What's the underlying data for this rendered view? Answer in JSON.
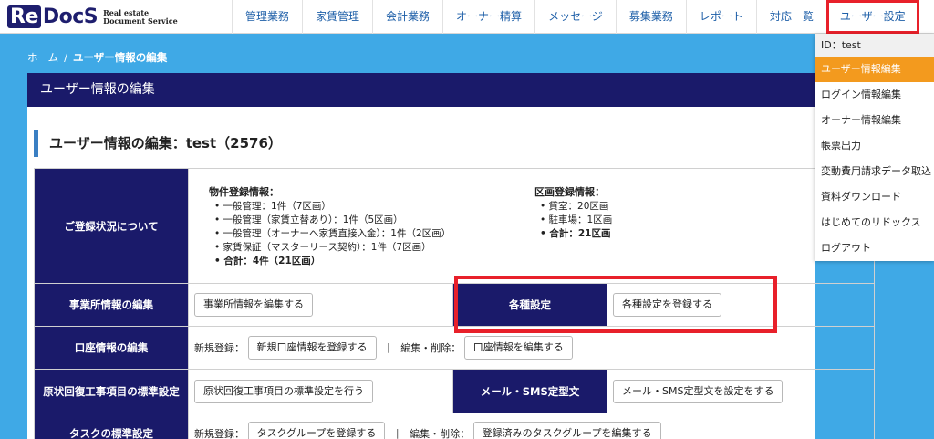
{
  "logo": {
    "mark_re": "Re",
    "mark_docs": "DocS",
    "sub_line1": "Real estate",
    "sub_line2": "Document Service"
  },
  "nav": [
    "管理業務",
    "家賃管理",
    "会計業務",
    "オーナー精算",
    "メッセージ",
    "募集業務",
    "レポート",
    "対応一覧",
    "ユーザー設定"
  ],
  "breadcrumb": {
    "home": "ホーム",
    "sep": "/",
    "current": "ユーザー情報の編集"
  },
  "panel": {
    "header": "ユーザー情報の編集",
    "title": "ユーザー情報の編集：test（2576）"
  },
  "registration": {
    "label": "ご登録状況について",
    "property_title": "物件登録情報：",
    "property_items": [
      "一般管理：1件（7区画）",
      "一般管理（家賃立替あり）：1件（5区画）",
      "一般管理（オーナーへ家賃直接入金）：1件（2区画）",
      "家賃保証（マスターリース契約）：1件（7区画）"
    ],
    "property_total": "合計：4件（21区画）",
    "unit_title": "区画登録情報：",
    "unit_items": [
      "貸室：20区画",
      "駐車場：1区画"
    ],
    "unit_total": "合計：21区画"
  },
  "rows": {
    "office": {
      "label": "事業所情報の編集",
      "button": "事業所情報を編集する"
    },
    "settings": {
      "label": "各種設定",
      "button": "各種設定を登録する"
    },
    "bank": {
      "label": "口座情報の編集",
      "new_label": "新規登録：",
      "new_button": "新規口座情報を登録する",
      "divider": "|",
      "edit_label": "編集・削除：",
      "edit_button": "口座情報を編集する"
    },
    "restore": {
      "label": "原状回復工事項目の標準設定",
      "button": "原状回復工事項目の標準設定を行う"
    },
    "mail": {
      "label": "メール・SMS定型文",
      "button": "メール・SMS定型文を設定をする"
    },
    "task": {
      "label": "タスクの標準設定",
      "new_label": "新規登録：",
      "new_button": "タスクグループを登録する",
      "divider": "|",
      "edit_label": "編集・削除：",
      "edit_button": "登録済みのタスクグループを編集する"
    }
  },
  "dropdown": {
    "id_text": "ID：test",
    "items": [
      "ユーザー情報編集",
      "ログイン情報編集",
      "オーナー情報編集",
      "帳票出力",
      "変動費用請求データ取込",
      "資料ダウンロード",
      "はじめてのリドックス",
      "ログアウト"
    ]
  },
  "colors": {
    "navy": "#1a1a6a",
    "accent_orange": "#f39a1e",
    "highlight_red": "#e8202a",
    "background_blue": "#3fa9e6"
  }
}
